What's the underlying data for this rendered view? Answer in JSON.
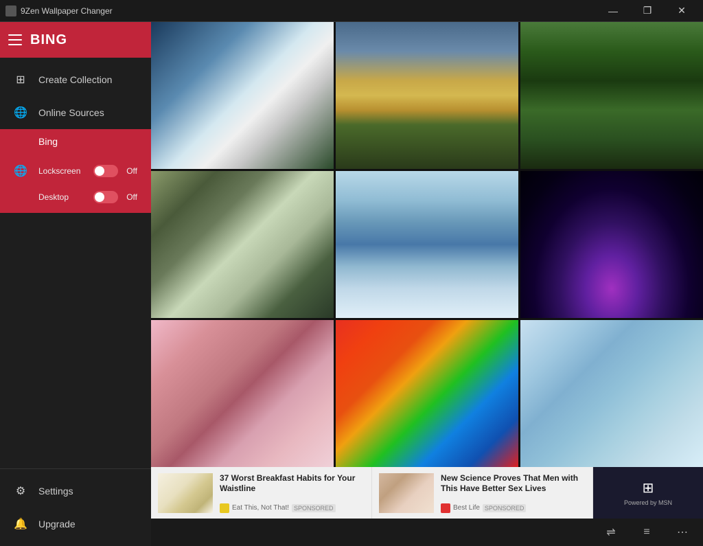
{
  "titlebar": {
    "title": "9Zen Wallpaper Changer",
    "controls": {
      "minimize": "—",
      "maximize": "❐",
      "close": "✕"
    }
  },
  "sidebar": {
    "header_title": "BING",
    "items": [
      {
        "id": "create-collection",
        "label": "Create Collection",
        "icon": "⊞"
      },
      {
        "id": "online-sources",
        "label": "Online Sources",
        "icon": "🌐"
      }
    ],
    "bing": {
      "label": "Bing",
      "icon": "🌐",
      "lockscreen_label": "Lockscreen",
      "lockscreen_value": "Off",
      "desktop_label": "Desktop",
      "desktop_value": "Off"
    },
    "footer": [
      {
        "id": "settings",
        "label": "Settings",
        "icon": "⚙"
      },
      {
        "id": "upgrade",
        "label": "Upgrade",
        "icon": "🔔"
      }
    ]
  },
  "ads": [
    {
      "title": "37 Worst Breakfast Habits for Your Waistline",
      "source_name": "Eat This, Not That!",
      "source_label": "SPONSORED"
    },
    {
      "title": "New Science Proves That Men with This Have Better Sex Lives",
      "source_name": "Best Life",
      "source_label": "SPONSORED"
    }
  ],
  "msn_label": "Powered by MSN",
  "bottom_bar": {
    "btn1": "⇌",
    "btn2": "≡",
    "btn3": "⋯"
  }
}
